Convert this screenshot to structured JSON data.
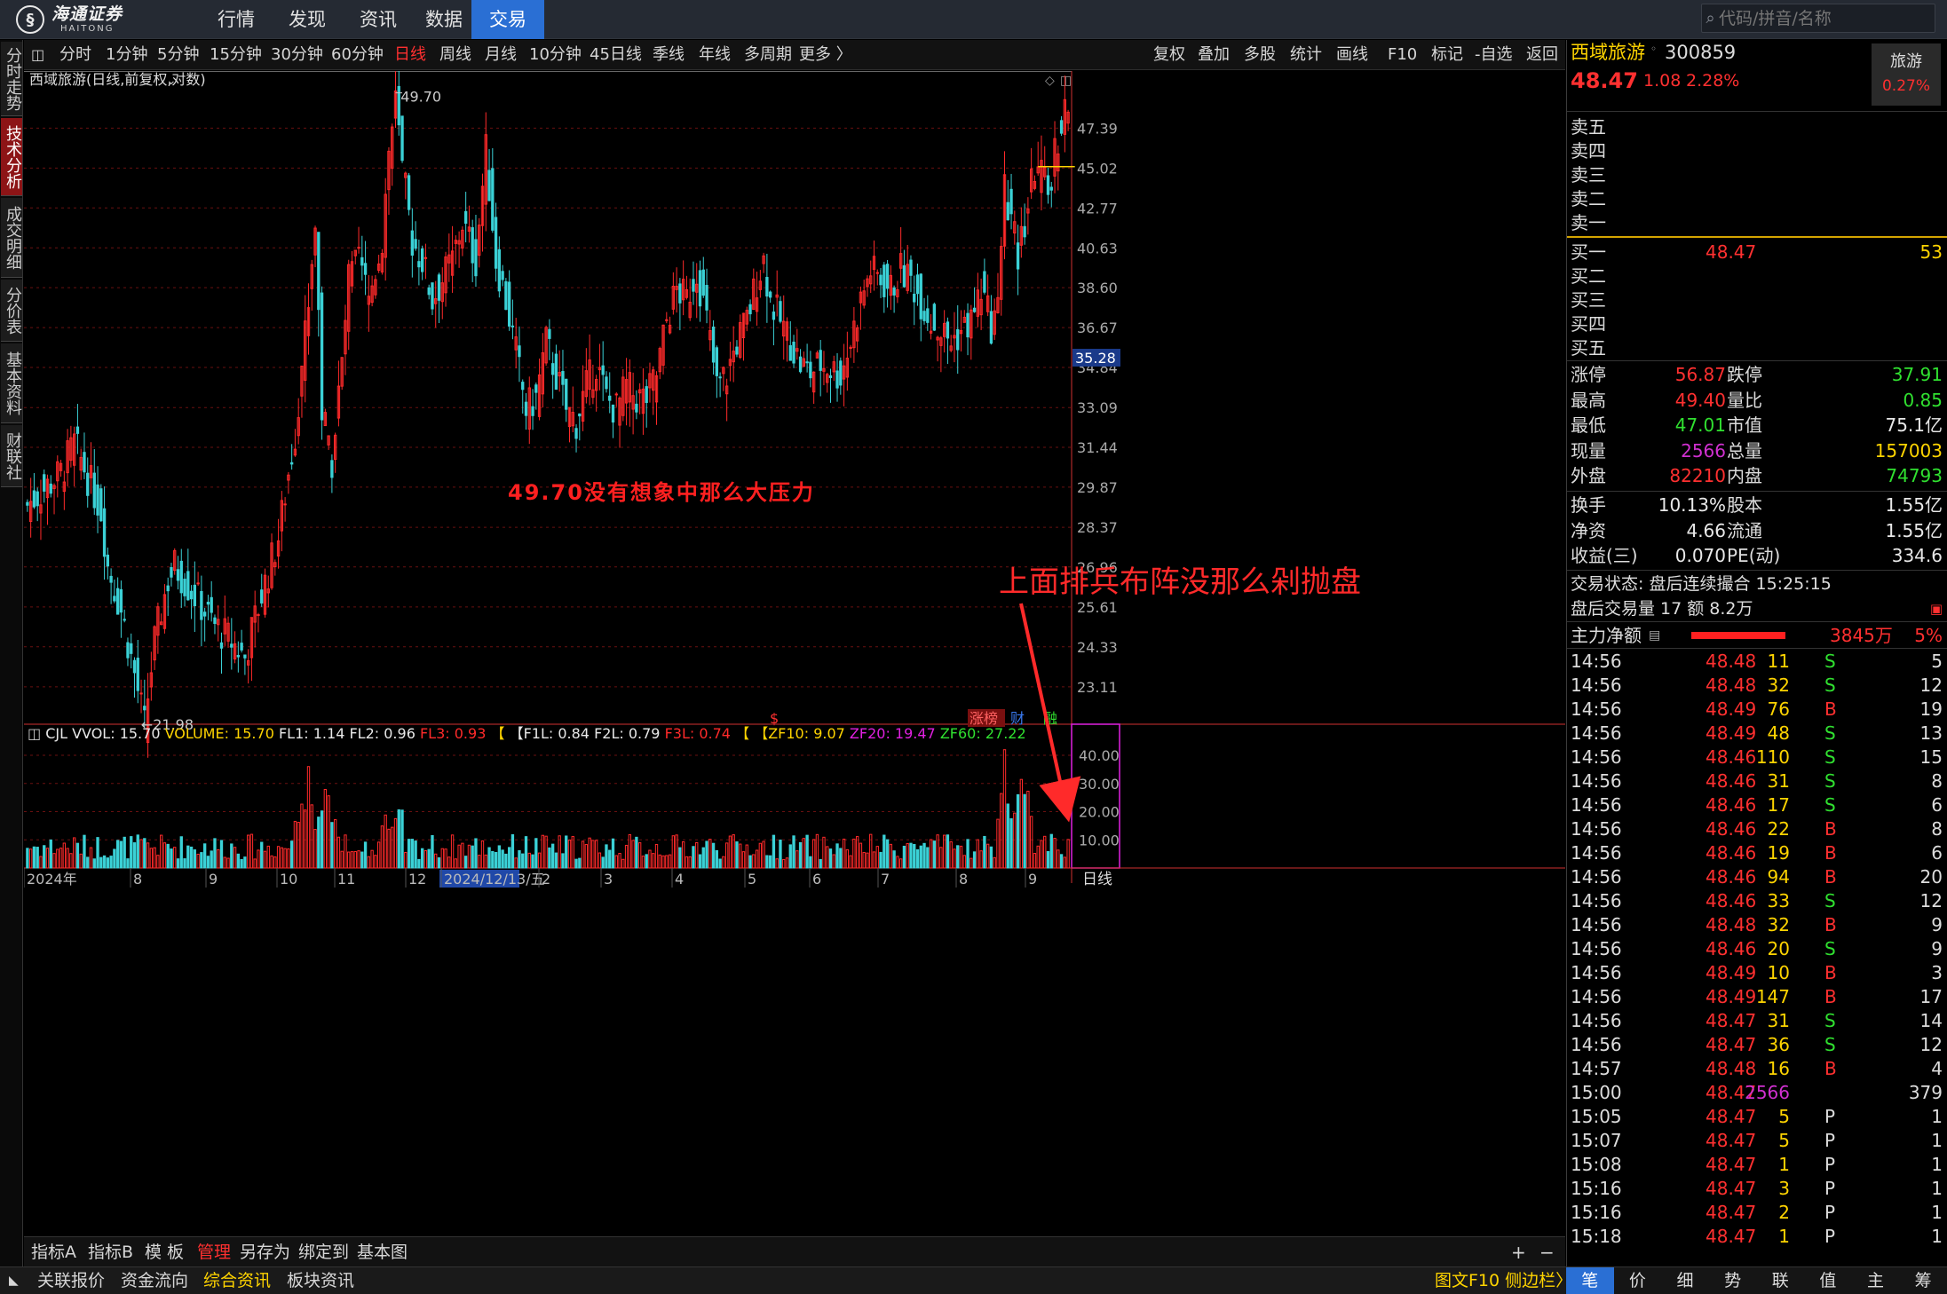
{
  "nav": {
    "logo_cn": "海通证券",
    "logo_en": "HAITONG",
    "items": [
      "行情",
      "发现",
      "资讯",
      "数据",
      "交易"
    ],
    "active": "交易",
    "search_placeholder": "代码/拼音/名称"
  },
  "vtabs": [
    "分时走势",
    "技术分析",
    "成交明细",
    "分价表",
    "基本资料",
    "财联社"
  ],
  "vtabs_active": "技术分析",
  "periods": [
    "分时",
    "1分钟",
    "5分钟",
    "15分钟",
    "30分钟",
    "60分钟",
    "日线",
    "周线",
    "月线",
    "10分钟",
    "45日线",
    "季线",
    "年线",
    "多周期",
    "更多 〉"
  ],
  "period_active": "日线",
  "tools": [
    "复权",
    "叠加",
    "多股",
    "统计",
    "画线",
    "F10",
    "标记",
    "-自选",
    "返回"
  ],
  "chart_title": "西域旅游(日线,前复权,对数)",
  "chart_data": {
    "type": "candlestick",
    "period": "日线",
    "price_axis_ticks": [
      "47.39",
      "45.02",
      "42.77",
      "40.63",
      "38.60",
      "36.67",
      "34.84",
      "33.09",
      "31.44",
      "29.87",
      "28.37",
      "26.96",
      "25.61",
      "24.33",
      "23.11"
    ],
    "price_range": [
      22.0,
      51.0
    ],
    "log_scale": true,
    "current_price_marker": "35.28",
    "high_label": "49.70",
    "low_label": "←21.98",
    "annotation_text": "49.70没有想象中那么大压力",
    "callout_text": "上面排兵布阵没那么剁抛盘",
    "event_tags": [
      "$",
      "涨榜",
      "财",
      "融"
    ],
    "x_labels": [
      "2024年",
      "8",
      "9",
      "10",
      "11",
      "12",
      "2024/12/13/五",
      "2",
      "3",
      "4",
      "5",
      "6",
      "7",
      "8",
      "9"
    ],
    "volume_indicator": {
      "name": "CJL",
      "items": [
        {
          "label": "VVOL: 15.70",
          "color": "#e8e8e8"
        },
        {
          "label": "VOLUME: 15.70",
          "color": "#ffd400"
        },
        {
          "label": "FL1: 1.14",
          "color": "#e8e8e8"
        },
        {
          "label": "FL2: 0.96",
          "color": "#e8e8e8"
        },
        {
          "label": "FL3: 0.93",
          "color": "#ff2a2a"
        },
        {
          "label": "【",
          "color": "#ffd400"
        },
        {
          "label": "【F1L: 0.84",
          "color": "#e8e8e8"
        },
        {
          "label": "F2L: 0.79",
          "color": "#e8e8e8"
        },
        {
          "label": "F3L: 0.74",
          "color": "#ff2a2a"
        },
        {
          "label": "【",
          "color": "#ffd400"
        },
        {
          "label": "【ZF10: 9.07",
          "color": "#ffd400"
        },
        {
          "label": "ZF20: 19.47",
          "color": "#e020e0"
        },
        {
          "label": "ZF60: 27.22",
          "color": "#30e030"
        }
      ],
      "axis_ticks": [
        "40.00",
        "30.00",
        "20.00",
        "10.00"
      ]
    },
    "bottom_period_label": "日线",
    "keypoints": [
      {
        "i": 0,
        "p": 29.2
      },
      {
        "i": 10,
        "p": 30.4
      },
      {
        "i": 14,
        "p": 31.6
      },
      {
        "i": 22,
        "p": 29.0
      },
      {
        "i": 24,
        "p": 27.0
      },
      {
        "i": 28,
        "p": 25.5
      },
      {
        "i": 33,
        "p": 23.0
      },
      {
        "i": 35,
        "p": 21.98
      },
      {
        "i": 38,
        "p": 24.5
      },
      {
        "i": 42,
        "p": 26.5
      },
      {
        "i": 44,
        "p": 27.0
      },
      {
        "i": 50,
        "p": 26.0
      },
      {
        "i": 56,
        "p": 25.0
      },
      {
        "i": 61,
        "p": 24.5
      },
      {
        "i": 65,
        "p": 24.0
      },
      {
        "i": 70,
        "p": 26.0
      },
      {
        "i": 75,
        "p": 28.0
      },
      {
        "i": 80,
        "p": 32.0
      },
      {
        "i": 84,
        "p": 38.0
      },
      {
        "i": 86,
        "p": 42.0
      },
      {
        "i": 88,
        "p": 33.0
      },
      {
        "i": 91,
        "p": 31.0
      },
      {
        "i": 94,
        "p": 35.0
      },
      {
        "i": 96,
        "p": 39.0
      },
      {
        "i": 99,
        "p": 40.0
      },
      {
        "i": 102,
        "p": 38.0
      },
      {
        "i": 106,
        "p": 41.0
      },
      {
        "i": 108,
        "p": 46.0
      },
      {
        "i": 110,
        "p": 49.0
      },
      {
        "i": 112,
        "p": 45.0
      },
      {
        "i": 115,
        "p": 41.0
      },
      {
        "i": 118,
        "p": 40.0
      },
      {
        "i": 121,
        "p": 38.0
      },
      {
        "i": 124,
        "p": 39.0
      },
      {
        "i": 127,
        "p": 40.0
      },
      {
        "i": 130,
        "p": 42.0
      },
      {
        "i": 134,
        "p": 40.0
      },
      {
        "i": 137,
        "p": 46.0
      },
      {
        "i": 140,
        "p": 40.0
      },
      {
        "i": 143,
        "p": 38.0
      },
      {
        "i": 146,
        "p": 35.5
      },
      {
        "i": 149,
        "p": 33.0
      },
      {
        "i": 152,
        "p": 33.5
      },
      {
        "i": 155,
        "p": 36.0
      },
      {
        "i": 158,
        "p": 34.5
      },
      {
        "i": 161,
        "p": 33.0
      },
      {
        "i": 164,
        "p": 32.5
      },
      {
        "i": 167,
        "p": 34.0
      },
      {
        "i": 170,
        "p": 35.0
      },
      {
        "i": 173,
        "p": 33.5
      },
      {
        "i": 176,
        "p": 33.0
      },
      {
        "i": 179,
        "p": 34.0
      },
      {
        "i": 182,
        "p": 33.5
      },
      {
        "i": 185,
        "p": 33.5
      },
      {
        "i": 188,
        "p": 34.5
      },
      {
        "i": 191,
        "p": 37.0
      },
      {
        "i": 194,
        "p": 38.5
      },
      {
        "i": 197,
        "p": 38.0
      },
      {
        "i": 200,
        "p": 39.5
      },
      {
        "i": 203,
        "p": 37.0
      },
      {
        "i": 206,
        "p": 34.0
      },
      {
        "i": 209,
        "p": 34.5
      },
      {
        "i": 212,
        "p": 36.0
      },
      {
        "i": 215,
        "p": 37.0
      },
      {
        "i": 218,
        "p": 39.0
      },
      {
        "i": 220,
        "p": 40.0
      },
      {
        "i": 222,
        "p": 38.0
      },
      {
        "i": 225,
        "p": 37.0
      },
      {
        "i": 228,
        "p": 36.0
      },
      {
        "i": 231,
        "p": 35.0
      },
      {
        "i": 234,
        "p": 34.6
      },
      {
        "i": 237,
        "p": 35.0
      },
      {
        "i": 240,
        "p": 34.8
      },
      {
        "i": 243,
        "p": 34.5
      },
      {
        "i": 246,
        "p": 36.0
      },
      {
        "i": 249,
        "p": 38.0
      },
      {
        "i": 252,
        "p": 39.5
      },
      {
        "i": 255,
        "p": 39.0
      },
      {
        "i": 258,
        "p": 38.5
      },
      {
        "i": 261,
        "p": 39.5
      },
      {
        "i": 264,
        "p": 39.0
      },
      {
        "i": 267,
        "p": 38.0
      },
      {
        "i": 270,
        "p": 37.0
      },
      {
        "i": 273,
        "p": 36.5
      },
      {
        "i": 276,
        "p": 36.0
      },
      {
        "i": 279,
        "p": 36.5
      },
      {
        "i": 282,
        "p": 37.0
      },
      {
        "i": 285,
        "p": 38.5
      },
      {
        "i": 288,
        "p": 36.8
      },
      {
        "i": 290,
        "p": 37.5
      },
      {
        "i": 292,
        "p": 44.0
      },
      {
        "i": 294,
        "p": 42.0
      },
      {
        "i": 296,
        "p": 40.0
      },
      {
        "i": 298,
        "p": 42.0
      },
      {
        "i": 301,
        "p": 45.0
      },
      {
        "i": 303,
        "p": 44.5
      },
      {
        "i": 305,
        "p": 43.5
      },
      {
        "i": 307,
        "p": 46.0
      },
      {
        "i": 310,
        "p": 48.47
      }
    ]
  },
  "quote": {
    "name": "西域旅游",
    "code": "300859",
    "price": "48.47",
    "change": "1.08",
    "pct": "2.28%",
    "sector": "旅游",
    "sector_pct": "0.27%",
    "asks": [
      {
        "label": "卖五",
        "p": "",
        "v": ""
      },
      {
        "label": "卖四",
        "p": "",
        "v": ""
      },
      {
        "label": "卖三",
        "p": "",
        "v": ""
      },
      {
        "label": "卖二",
        "p": "",
        "v": ""
      },
      {
        "label": "卖一",
        "p": "",
        "v": ""
      }
    ],
    "bids": [
      {
        "label": "买一",
        "p": "48.47",
        "v": "53"
      },
      {
        "label": "买二",
        "p": "",
        "v": ""
      },
      {
        "label": "买三",
        "p": "",
        "v": ""
      },
      {
        "label": "买四",
        "p": "",
        "v": ""
      },
      {
        "label": "买五",
        "p": "",
        "v": ""
      }
    ],
    "stats": [
      {
        "l1": "涨停",
        "v1": "56.87",
        "c1": "#ff3030",
        "l2": "跌停",
        "v2": "37.91",
        "c2": "#30e030"
      },
      {
        "l1": "最高",
        "v1": "49.40",
        "c1": "#ff3030",
        "l2": "量比",
        "v2": "0.85",
        "c2": "#30e030"
      },
      {
        "l1": "最低",
        "v1": "47.01",
        "c1": "#30e030",
        "l2": "市值",
        "v2": "75.1亿",
        "c2": "#e8e8e8"
      },
      {
        "l1": "现量",
        "v1": "2566",
        "c1": "#d030d0",
        "l2": "总量",
        "v2": "157003",
        "c2": "#ffd400"
      },
      {
        "l1": "外盘",
        "v1": "82210",
        "c1": "#ff3030",
        "l2": "内盘",
        "v2": "74793",
        "c2": "#30e030"
      }
    ],
    "stats2": [
      {
        "l1": "换手",
        "v1": "10.13%",
        "c1": "#e8e8e8",
        "l2": "股本",
        "v2": "1.55亿",
        "c2": "#e8e8e8"
      },
      {
        "l1": "净资",
        "v1": "4.66",
        "c1": "#e8e8e8",
        "l2": "流通",
        "v2": "1.55亿",
        "c2": "#e8e8e8"
      },
      {
        "l1": "收益(三)",
        "v1": "0.070",
        "c1": "#e8e8e8",
        "l2": "PE(动)",
        "v2": "334.6",
        "c2": "#e8e8e8"
      }
    ],
    "trade_status": "交易状态: 盘后连续撮合 15:25:15",
    "after_hours": "盘后交易量 17 额 8.2万",
    "main_force": {
      "label": "主力净额",
      "value": "3845万",
      "pct": "5%"
    },
    "ticks": [
      {
        "t": "14:56",
        "p": "48.48",
        "v": "11",
        "d": "S",
        "n": "5"
      },
      {
        "t": "14:56",
        "p": "48.48",
        "v": "32",
        "d": "S",
        "n": "12"
      },
      {
        "t": "14:56",
        "p": "48.49",
        "v": "76",
        "d": "B",
        "n": "19"
      },
      {
        "t": "14:56",
        "p": "48.49",
        "v": "48",
        "d": "S",
        "n": "13"
      },
      {
        "t": "14:56",
        "p": "48.46",
        "v": "110",
        "d": "S",
        "n": "15"
      },
      {
        "t": "14:56",
        "p": "48.46",
        "v": "31",
        "d": "S",
        "n": "8"
      },
      {
        "t": "14:56",
        "p": "48.46",
        "v": "17",
        "d": "S",
        "n": "6"
      },
      {
        "t": "14:56",
        "p": "48.46",
        "v": "22",
        "d": "B",
        "n": "8"
      },
      {
        "t": "14:56",
        "p": "48.46",
        "v": "19",
        "d": "B",
        "n": "6"
      },
      {
        "t": "14:56",
        "p": "48.46",
        "v": "94",
        "d": "B",
        "n": "20"
      },
      {
        "t": "14:56",
        "p": "48.46",
        "v": "33",
        "d": "S",
        "n": "12"
      },
      {
        "t": "14:56",
        "p": "48.48",
        "v": "32",
        "d": "B",
        "n": "9"
      },
      {
        "t": "14:56",
        "p": "48.46",
        "v": "20",
        "d": "S",
        "n": "9"
      },
      {
        "t": "14:56",
        "p": "48.49",
        "v": "10",
        "d": "B",
        "n": "3"
      },
      {
        "t": "14:56",
        "p": "48.49",
        "v": "147",
        "d": "B",
        "n": "17"
      },
      {
        "t": "14:56",
        "p": "48.47",
        "v": "31",
        "d": "S",
        "n": "14"
      },
      {
        "t": "14:56",
        "p": "48.47",
        "v": "36",
        "d": "S",
        "n": "12"
      },
      {
        "t": "14:57",
        "p": "48.48",
        "v": "16",
        "d": "B",
        "n": "4"
      },
      {
        "t": "15:00",
        "p": "48.47",
        "v": "2566",
        "d": "",
        "n": "379"
      },
      {
        "t": "15:05",
        "p": "48.47",
        "v": "5",
        "d": "P",
        "n": "1"
      },
      {
        "t": "15:07",
        "p": "48.47",
        "v": "5",
        "d": "P",
        "n": "1"
      },
      {
        "t": "15:08",
        "p": "48.47",
        "v": "1",
        "d": "P",
        "n": "1"
      },
      {
        "t": "15:16",
        "p": "48.47",
        "v": "3",
        "d": "P",
        "n": "1"
      },
      {
        "t": "15:16",
        "p": "48.47",
        "v": "2",
        "d": "P",
        "n": "1"
      },
      {
        "t": "15:18",
        "p": "48.47",
        "v": "1",
        "d": "P",
        "n": "1"
      }
    ],
    "bottom_tabs": [
      "笔",
      "价",
      "细",
      "势",
      "联",
      "值",
      "主",
      "筹"
    ],
    "bottom_active": "笔"
  },
  "bottom_bar1": [
    "指标A",
    "指标B",
    "模 板",
    "管理",
    "另存为",
    "绑定到",
    "基本图"
  ],
  "bottom_bar1_active": "管理",
  "bottom_bar2": [
    "关联报价",
    "资金流向",
    "综合资讯",
    "板块资讯"
  ],
  "bottom_bar2_active": "综合资讯",
  "bottom_right": "图文F10 侧边栏〉",
  "colors": {
    "up": "#ff2a2a",
    "down": "#3bd1d6",
    "grid": "#6a1010",
    "accent": "#2a6fd4",
    "yellow": "#ffd400"
  }
}
